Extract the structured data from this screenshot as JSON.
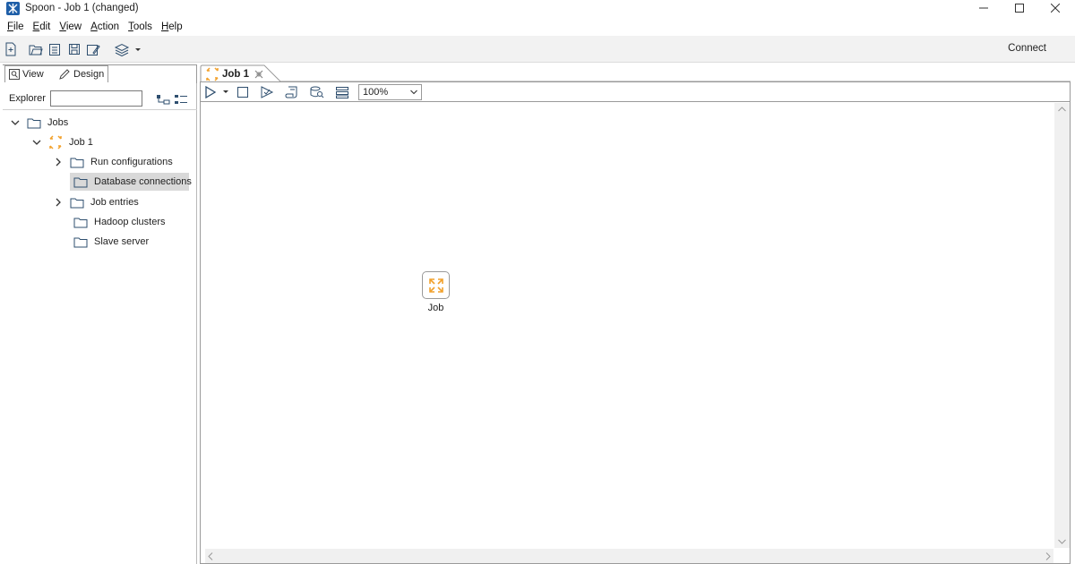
{
  "window": {
    "title": "Spoon - Job 1 (changed)"
  },
  "menu": {
    "items": [
      {
        "u": "F",
        "rest": "ile"
      },
      {
        "u": "E",
        "rest": "dit"
      },
      {
        "u": "V",
        "rest": "iew"
      },
      {
        "u": "A",
        "rest": "ction"
      },
      {
        "u": "T",
        "rest": "ools"
      },
      {
        "u": "H",
        "rest": "elp"
      }
    ]
  },
  "toolbar": {
    "connect_label": "Connect"
  },
  "left_panel": {
    "tabs": {
      "view": "View",
      "design": "Design"
    },
    "explorer_label": "Explorer",
    "explorer_value": "",
    "tree": {
      "root": "Jobs",
      "job": "Job 1",
      "children": [
        "Run configurations",
        "Database connections",
        "Job entries",
        "Hadoop clusters",
        "Slave server"
      ]
    }
  },
  "editor": {
    "tab_label": "Job 1",
    "zoom_value": "100%"
  },
  "canvas": {
    "entry_label": "Job"
  },
  "colors": {
    "accent_orange": "#f2a12c",
    "app_blue": "#1f5fa8",
    "selection": "#d9d9d9"
  }
}
